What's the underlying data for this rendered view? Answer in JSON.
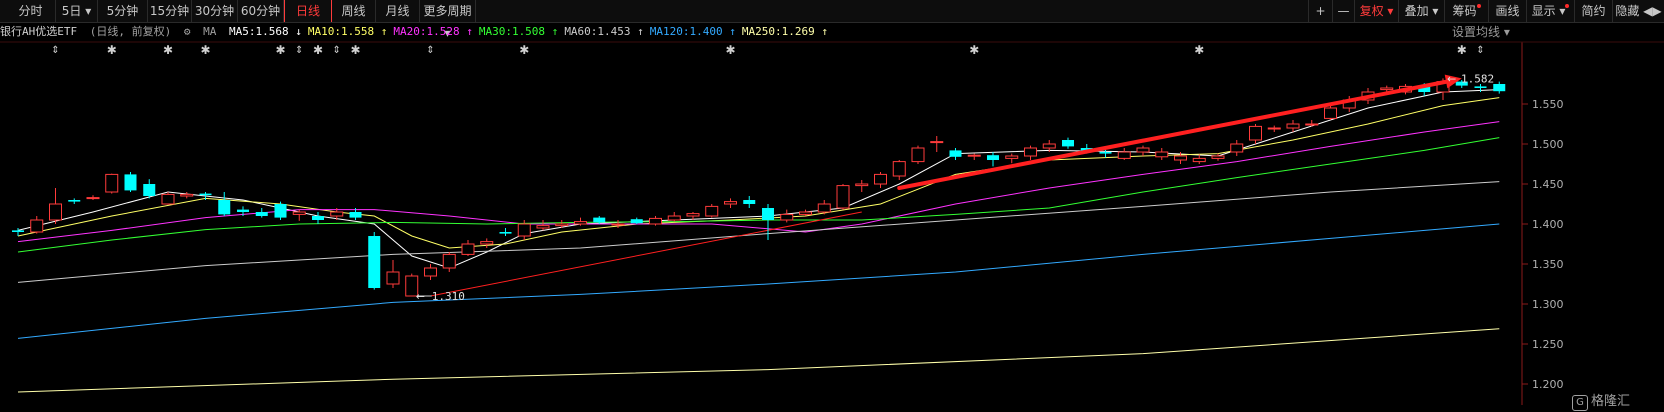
{
  "toolbar": {
    "tabs": [
      {
        "label": "分时"
      },
      {
        "label": "5日 ▾"
      },
      {
        "label": "5分钟"
      },
      {
        "label": "15分钟"
      },
      {
        "label": "30分钟"
      },
      {
        "label": "60分钟"
      },
      {
        "label": "日线",
        "active": true
      },
      {
        "label": "周线"
      },
      {
        "label": "月线"
      },
      {
        "label": "更多周期 ▾"
      }
    ],
    "right": [
      {
        "label": "+"
      },
      {
        "label": "—"
      },
      {
        "label": "复权 ▾",
        "red": true
      },
      {
        "label": "叠加 ▾"
      },
      {
        "label": "筹码",
        "dot": true
      },
      {
        "label": "画线"
      },
      {
        "label": "显示 ▾",
        "dot": true
      },
      {
        "label": "简约"
      },
      {
        "label": "隐藏 ◀▶"
      }
    ]
  },
  "infobar": {
    "title": "银行AH优选ETF",
    "subtitle": "(日线, 前复权)",
    "ma_label": "MA",
    "ma": [
      {
        "text": "MA5:1.568 ↓",
        "color": "#ffffff"
      },
      {
        "text": "MA10:1.558 ↑",
        "color": "#ffff66"
      },
      {
        "text": "MA20:1.528 ↑",
        "color": "#ff33ff"
      },
      {
        "text": "MA30:1.508 ↑",
        "color": "#33ff33"
      },
      {
        "text": "MA60:1.453 ↑",
        "color": "#cccccc"
      },
      {
        "text": "MA120:1.400 ↑",
        "color": "#33aaff"
      },
      {
        "text": "MA250:1.269 ↑",
        "color": "#ffffaa"
      }
    ],
    "setting": "设置均线 ▾"
  },
  "chart_data": {
    "type": "candlestick",
    "ylim": [
      1.18,
      1.605
    ],
    "yticks": [
      "1.550",
      "1.500",
      "1.450",
      "1.400",
      "1.350",
      "1.300",
      "1.250",
      "1.200"
    ],
    "ytick_values": [
      1.55,
      1.5,
      1.45,
      1.4,
      1.35,
      1.3,
      1.25,
      1.2
    ],
    "annotations": {
      "high_label": "1.582",
      "high_value": 1.582,
      "low_label": "1.310",
      "low_value": 1.31
    },
    "candles": [
      [
        1.392,
        1.39,
        1.395,
        1.385,
        0
      ],
      [
        1.39,
        1.405,
        1.41,
        1.388,
        1
      ],
      [
        1.405,
        1.425,
        1.445,
        1.4,
        1
      ],
      [
        1.43,
        1.428,
        1.432,
        1.425,
        0
      ],
      [
        1.432,
        1.433,
        1.436,
        1.43,
        1
      ],
      [
        1.44,
        1.462,
        1.463,
        1.438,
        1
      ],
      [
        1.462,
        1.442,
        1.465,
        1.44,
        0
      ],
      [
        1.45,
        1.435,
        1.456,
        1.432,
        0
      ],
      [
        1.425,
        1.437,
        1.44,
        1.424,
        1
      ],
      [
        1.435,
        1.437,
        1.44,
        1.432,
        1
      ],
      [
        1.438,
        1.436,
        1.44,
        1.43,
        0
      ],
      [
        1.43,
        1.412,
        1.44,
        1.41,
        0
      ],
      [
        1.418,
        1.415,
        1.422,
        1.41,
        0
      ],
      [
        1.415,
        1.41,
        1.42,
        1.408,
        0
      ],
      [
        1.425,
        1.408,
        1.428,
        1.405,
        0
      ],
      [
        1.412,
        1.415,
        1.418,
        1.404,
        1
      ],
      [
        1.41,
        1.405,
        1.415,
        1.4,
        0
      ],
      [
        1.41,
        1.415,
        1.42,
        1.405,
        1
      ],
      [
        1.415,
        1.408,
        1.42,
        1.405,
        0
      ],
      [
        1.385,
        1.32,
        1.39,
        1.318,
        0
      ],
      [
        1.325,
        1.34,
        1.355,
        1.32,
        1
      ],
      [
        1.31,
        1.335,
        1.338,
        1.31,
        1
      ],
      [
        1.335,
        1.345,
        1.35,
        1.33,
        1
      ],
      [
        1.345,
        1.362,
        1.365,
        1.34,
        1
      ],
      [
        1.362,
        1.375,
        1.38,
        1.36,
        1
      ],
      [
        1.375,
        1.378,
        1.382,
        1.37,
        1
      ],
      [
        1.39,
        1.388,
        1.395,
        1.385,
        0
      ],
      [
        1.385,
        1.4,
        1.405,
        1.38,
        1
      ],
      [
        1.395,
        1.398,
        1.405,
        1.392,
        1
      ],
      [
        1.398,
        1.4,
        1.405,
        1.395,
        1
      ],
      [
        1.4,
        1.403,
        1.408,
        1.398,
        1
      ],
      [
        1.408,
        1.402,
        1.41,
        1.4,
        0
      ],
      [
        1.4,
        1.4,
        1.405,
        1.395,
        1
      ],
      [
        1.406,
        1.401,
        1.408,
        1.4,
        0
      ],
      [
        1.4,
        1.407,
        1.41,
        1.398,
        1
      ],
      [
        1.405,
        1.41,
        1.415,
        1.403,
        1
      ],
      [
        1.41,
        1.413,
        1.415,
        1.405,
        1
      ],
      [
        1.41,
        1.422,
        1.425,
        1.408,
        1
      ],
      [
        1.425,
        1.428,
        1.432,
        1.42,
        1
      ],
      [
        1.43,
        1.425,
        1.435,
        1.42,
        0
      ],
      [
        1.42,
        1.405,
        1.425,
        1.38,
        0
      ],
      [
        1.405,
        1.412,
        1.418,
        1.402,
        1
      ],
      [
        1.412,
        1.415,
        1.418,
        1.41,
        1
      ],
      [
        1.415,
        1.425,
        1.43,
        1.412,
        1
      ],
      [
        1.42,
        1.448,
        1.45,
        1.418,
        1
      ],
      [
        1.448,
        1.45,
        1.455,
        1.44,
        1
      ],
      [
        1.45,
        1.462,
        1.465,
        1.445,
        1
      ],
      [
        1.46,
        1.478,
        1.48,
        1.455,
        1
      ],
      [
        1.478,
        1.495,
        1.498,
        1.475,
        1
      ],
      [
        1.502,
        1.503,
        1.51,
        1.49,
        1
      ],
      [
        1.492,
        1.484,
        1.495,
        1.48,
        0
      ],
      [
        1.485,
        1.486,
        1.488,
        1.48,
        1
      ],
      [
        1.486,
        1.48,
        1.49,
        1.472,
        0
      ],
      [
        1.482,
        1.485,
        1.488,
        1.476,
        1
      ],
      [
        1.485,
        1.495,
        1.498,
        1.48,
        1
      ],
      [
        1.495,
        1.5,
        1.505,
        1.49,
        1
      ],
      [
        1.505,
        1.497,
        1.508,
        1.494,
        0
      ],
      [
        1.495,
        1.49,
        1.5,
        1.488,
        0
      ],
      [
        1.49,
        1.488,
        1.493,
        1.483,
        0
      ],
      [
        1.482,
        1.49,
        1.495,
        1.48,
        1
      ],
      [
        1.49,
        1.495,
        1.498,
        1.485,
        1
      ],
      [
        1.484,
        1.49,
        1.495,
        1.48,
        1
      ],
      [
        1.48,
        1.485,
        1.49,
        1.475,
        1
      ],
      [
        1.478,
        1.482,
        1.487,
        1.475,
        1
      ],
      [
        1.482,
        1.485,
        1.488,
        1.479,
        1
      ],
      [
        1.49,
        1.5,
        1.505,
        1.485,
        1
      ],
      [
        1.505,
        1.522,
        1.525,
        1.5,
        1
      ],
      [
        1.52,
        1.52,
        1.523,
        1.515,
        1
      ],
      [
        1.52,
        1.525,
        1.53,
        1.515,
        1
      ],
      [
        1.525,
        1.525,
        1.53,
        1.522,
        1
      ],
      [
        1.532,
        1.545,
        1.55,
        1.53,
        1
      ],
      [
        1.545,
        1.555,
        1.56,
        1.54,
        1
      ],
      [
        1.555,
        1.565,
        1.57,
        1.55,
        1
      ],
      [
        1.568,
        1.57,
        1.573,
        1.565,
        1
      ],
      [
        1.565,
        1.572,
        1.575,
        1.562,
        1
      ],
      [
        1.572,
        1.565,
        1.576,
        1.56,
        0
      ],
      [
        1.565,
        1.578,
        1.582,
        1.555,
        1
      ],
      [
        1.578,
        1.573,
        1.58,
        1.57,
        0
      ],
      [
        1.572,
        1.57,
        1.575,
        1.565,
        0
      ],
      [
        1.575,
        1.566,
        1.578,
        1.563,
        0
      ]
    ],
    "series": [
      {
        "name": "MA5",
        "color": "#ffffff",
        "points": [
          [
            0,
            1.392
          ],
          [
            4,
            1.415
          ],
          [
            8,
            1.44
          ],
          [
            12,
            1.43
          ],
          [
            16,
            1.41
          ],
          [
            19,
            1.4
          ],
          [
            21,
            1.36
          ],
          [
            23,
            1.345
          ],
          [
            25,
            1.365
          ],
          [
            27,
            1.388
          ],
          [
            30,
            1.4
          ],
          [
            35,
            1.405
          ],
          [
            40,
            1.41
          ],
          [
            44,
            1.42
          ],
          [
            47,
            1.45
          ],
          [
            50,
            1.488
          ],
          [
            55,
            1.492
          ],
          [
            60,
            1.49
          ],
          [
            64,
            1.485
          ],
          [
            68,
            1.515
          ],
          [
            72,
            1.545
          ],
          [
            76,
            1.565
          ],
          [
            79,
            1.568
          ]
        ]
      },
      {
        "name": "MA10",
        "color": "#ffff66",
        "points": [
          [
            0,
            1.385
          ],
          [
            5,
            1.41
          ],
          [
            10,
            1.432
          ],
          [
            14,
            1.425
          ],
          [
            17,
            1.415
          ],
          [
            19,
            1.41
          ],
          [
            21,
            1.385
          ],
          [
            23,
            1.37
          ],
          [
            26,
            1.375
          ],
          [
            29,
            1.39
          ],
          [
            33,
            1.4
          ],
          [
            38,
            1.405
          ],
          [
            42,
            1.41
          ],
          [
            46,
            1.425
          ],
          [
            50,
            1.462
          ],
          [
            55,
            1.48
          ],
          [
            60,
            1.485
          ],
          [
            64,
            1.488
          ],
          [
            68,
            1.505
          ],
          [
            72,
            1.525
          ],
          [
            76,
            1.548
          ],
          [
            79,
            1.558
          ]
        ]
      },
      {
        "name": "MA20",
        "color": "#ff33ff",
        "points": [
          [
            0,
            1.378
          ],
          [
            5,
            1.392
          ],
          [
            10,
            1.408
          ],
          [
            15,
            1.418
          ],
          [
            19,
            1.418
          ],
          [
            23,
            1.41
          ],
          [
            27,
            1.4
          ],
          [
            32,
            1.4
          ],
          [
            37,
            1.4
          ],
          [
            42,
            1.39
          ],
          [
            45,
            1.4
          ],
          [
            50,
            1.425
          ],
          [
            55,
            1.445
          ],
          [
            60,
            1.462
          ],
          [
            65,
            1.478
          ],
          [
            70,
            1.497
          ],
          [
            75,
            1.515
          ],
          [
            79,
            1.528
          ]
        ]
      },
      {
        "name": "MA30",
        "color": "#33ff33",
        "points": [
          [
            0,
            1.365
          ],
          [
            5,
            1.38
          ],
          [
            10,
            1.393
          ],
          [
            15,
            1.4
          ],
          [
            20,
            1.402
          ],
          [
            25,
            1.4
          ],
          [
            30,
            1.402
          ],
          [
            35,
            1.403
          ],
          [
            40,
            1.405
          ],
          [
            45,
            1.405
          ],
          [
            50,
            1.412
          ],
          [
            55,
            1.42
          ],
          [
            60,
            1.44
          ],
          [
            65,
            1.458
          ],
          [
            70,
            1.475
          ],
          [
            75,
            1.492
          ],
          [
            79,
            1.508
          ]
        ]
      },
      {
        "name": "MA60",
        "color": "#cccccc",
        "points": [
          [
            0,
            1.327
          ],
          [
            10,
            1.348
          ],
          [
            20,
            1.362
          ],
          [
            30,
            1.37
          ],
          [
            40,
            1.388
          ],
          [
            50,
            1.405
          ],
          [
            60,
            1.422
          ],
          [
            70,
            1.44
          ],
          [
            79,
            1.453
          ]
        ]
      },
      {
        "name": "MA120",
        "color": "#33aaff",
        "points": [
          [
            0,
            1.257
          ],
          [
            10,
            1.282
          ],
          [
            20,
            1.302
          ],
          [
            30,
            1.312
          ],
          [
            40,
            1.325
          ],
          [
            50,
            1.34
          ],
          [
            60,
            1.362
          ],
          [
            70,
            1.382
          ],
          [
            79,
            1.4
          ]
        ]
      },
      {
        "name": "MA250",
        "color": "#ffffaa",
        "points": [
          [
            0,
            1.19
          ],
          [
            20,
            1.206
          ],
          [
            40,
            1.218
          ],
          [
            60,
            1.238
          ],
          [
            79,
            1.269
          ]
        ]
      }
    ],
    "trendline_thin": [
      [
        22,
        1.31
      ],
      [
        45,
        1.415
      ]
    ],
    "trendline_thick": [
      [
        47,
        1.445
      ],
      [
        77,
        1.582
      ]
    ],
    "markers_updown": [
      2,
      15,
      17,
      22,
      78
    ],
    "markers_star": [
      5,
      8,
      10,
      14,
      16,
      18,
      27,
      38,
      51,
      63,
      77
    ]
  },
  "watermark": "格隆汇"
}
